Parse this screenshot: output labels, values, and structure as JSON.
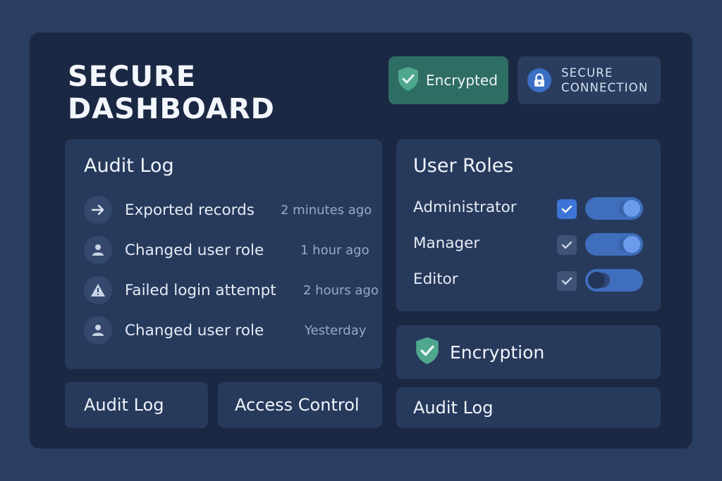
{
  "header": {
    "title_line1": "SECURE",
    "title_line2": "DASHBOARD",
    "badge_encrypted": "Encrypted",
    "badge_secure_line1": "SECURE",
    "badge_secure_line2": "CONNECTION"
  },
  "audit_log": {
    "title": "Audit Log",
    "entries": [
      {
        "icon": "arrow-right-icon",
        "text": "Exported records",
        "time": "2 minutes ago"
      },
      {
        "icon": "user-icon",
        "text": "Changed user role",
        "time": "1 hour ago"
      },
      {
        "icon": "warning-icon",
        "text": "Failed login attempt",
        "time": "2 hours ago"
      },
      {
        "icon": "user-icon",
        "text": "Changed user role",
        "time": "Yesterday"
      }
    ]
  },
  "user_roles": {
    "title": "User Roles",
    "roles": [
      {
        "label": "Administrator",
        "checked": true,
        "enabled": true
      },
      {
        "label": "Manager",
        "checked": true,
        "enabled": true
      },
      {
        "label": "Editor",
        "checked": true,
        "enabled": false
      }
    ]
  },
  "encryption_card": {
    "label": "Encryption"
  },
  "bottom_cards": {
    "audit_log": "Audit Log",
    "access_control": "Access Control",
    "audit_log_right": "Audit Log"
  },
  "colors": {
    "background": "#2a3e62",
    "frame": "#1b2844",
    "panel": "#273a5c",
    "accent_green": "#2e6d64",
    "shield_green": "#4fa88e",
    "accent_blue": "#3e74d6"
  }
}
